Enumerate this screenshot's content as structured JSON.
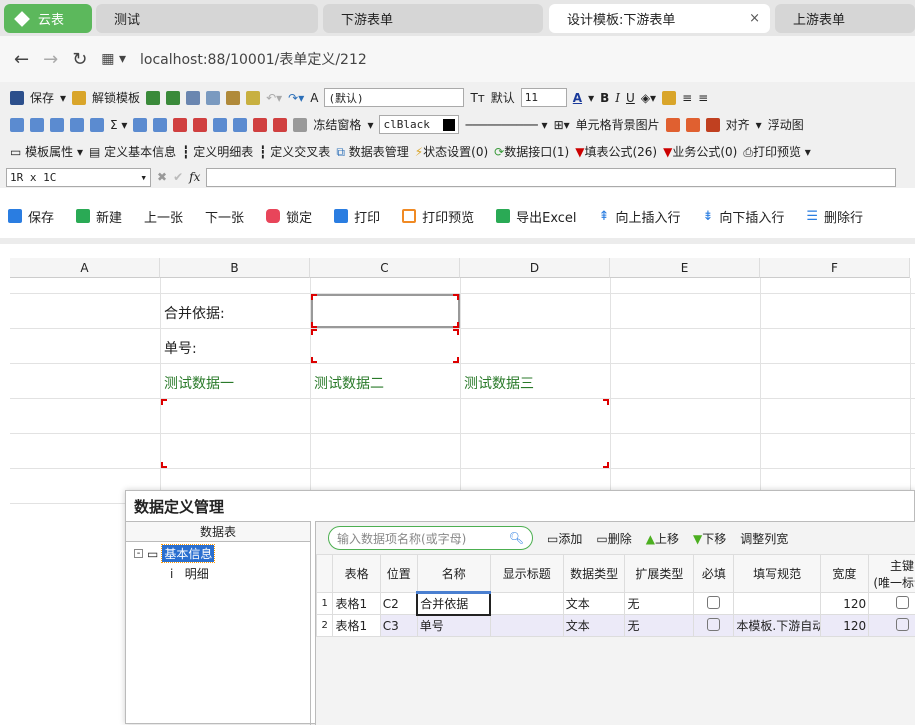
{
  "tabs": {
    "home": "云表",
    "items": [
      "测试",
      "下游表单",
      "设计模板:下游表单",
      "上游表单"
    ]
  },
  "address": "localhost:88/10001/表单定义/212",
  "toolbar1": {
    "save": "保存",
    "unlock": "解锁模板",
    "font": "(默认)",
    "font_size_label": "默认",
    "size": "11"
  },
  "toolbar2": {
    "freeze": "冻结窗格",
    "color": "clBlack",
    "bg_image": "单元格背景图片",
    "align": "对齐",
    "float": "浮动图"
  },
  "toolbar3": [
    "模板属性",
    "定义基本信息",
    "定义明细表",
    "定义交叉表",
    "数据表管理",
    "状态设置(0)",
    "数据接口(1)",
    "填表公式(26)",
    "业务公式(0)",
    "打印预览"
  ],
  "formula": {
    "cell_ref": "1R x 1C",
    "fx": "fx"
  },
  "actions": [
    "保存",
    "新建",
    "上一张",
    "下一张",
    "锁定",
    "打印",
    "打印预览",
    "导出Excel",
    "向上插入行",
    "向下插入行",
    "删除行"
  ],
  "sheet": {
    "columns": [
      "A",
      "B",
      "C",
      "D",
      "E",
      "F"
    ],
    "cells": {
      "b2": "合并依据:",
      "b3": "单号:",
      "b4": "测试数据一",
      "c4": "测试数据二",
      "d4": "测试数据三"
    }
  },
  "dialog": {
    "title": "数据定义管理",
    "tree_header": "数据表",
    "tree": [
      "基本信息",
      "明细"
    ],
    "search_placeholder": "输入数据项名称(或字母)",
    "buttons": [
      "添加",
      "删除",
      "上移",
      "下移",
      "调整列宽"
    ],
    "headers": [
      "表格",
      "位置",
      "名称",
      "显示标题",
      "数据类型",
      "扩展类型",
      "必填",
      "填写规范",
      "宽度",
      "主键",
      "(唯一标识)"
    ],
    "rows": [
      {
        "n": "1",
        "table": "表格1",
        "pos": "C2",
        "name": "合并依据",
        "title": "",
        "type": "文本",
        "ext": "无",
        "rule": "",
        "width": "120"
      },
      {
        "n": "2",
        "table": "表格1",
        "pos": "C3",
        "name": "单号",
        "title": "",
        "type": "文本",
        "ext": "无",
        "rule": "本模板.下游自动",
        "width": "120"
      }
    ]
  }
}
